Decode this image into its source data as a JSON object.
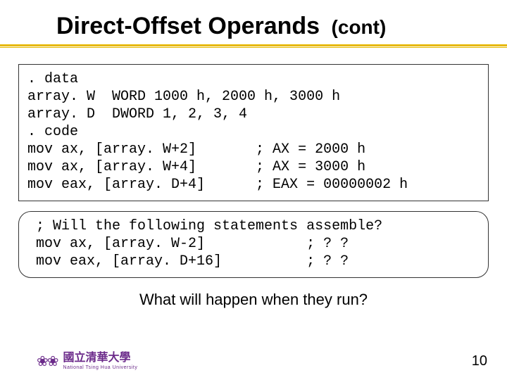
{
  "title": {
    "main": "Direct-Offset Operands",
    "cont": "(cont)"
  },
  "code1": {
    "l1": ". data",
    "l2": "array. W  WORD 1000 h, 2000 h, 3000 h",
    "l3": "array. D  DWORD 1, 2, 3, 4",
    "l4": ". code",
    "l5": "mov ax, [array. W+2]       ; AX = 2000 h",
    "l6": "mov ax, [array. W+4]       ; AX = 3000 h",
    "l7": "mov eax, [array. D+4]      ; EAX = 00000002 h"
  },
  "code2": {
    "l1": " ; Will the following statements assemble?",
    "l2": " mov ax, [array. W-2]            ; ? ?",
    "l3": " mov eax, [array. D+16]          ; ? ?"
  },
  "question": "What will happen when they run?",
  "footer": {
    "logo_cn": "國立清華大學",
    "logo_en": "National Tsing Hua University",
    "page": "10"
  }
}
